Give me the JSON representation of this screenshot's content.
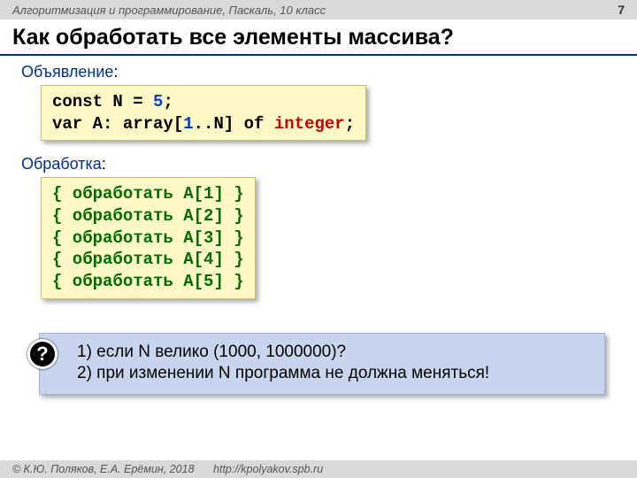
{
  "header": {
    "course": "Алгоритмизация и программирование, Паскаль, 10 класс",
    "page": "7"
  },
  "title": "Как обработать все элементы массива?",
  "sections": {
    "decl_label": "Объявление",
    "proc_label": "Обработка"
  },
  "code_decl": {
    "p1": "const N",
    "eq": "=",
    "five": "5",
    "semi1": ";",
    "p2": "var A: array[",
    "one": "1",
    "range": "..N] ",
    "of": "of",
    "sp": " ",
    "int": "integer",
    "semi2": ";"
  },
  "code_proc": {
    "l1_a": "{ обработать A[",
    "l1_b": "1",
    "l1_c": "] }",
    "l2_a": "{ обработать A[",
    "l2_b": "2",
    "l2_c": "] }",
    "l3_a": "{ обработать A[",
    "l3_b": "3",
    "l3_c": "] }",
    "l4_a": "{ обработать A[",
    "l4_b": "4",
    "l4_c": "] }",
    "l5_a": "{ обработать A[",
    "l5_b": "5",
    "l5_c": "] }"
  },
  "question": {
    "mark": "?",
    "line1": "1) если N велико (1000, 1000000)?",
    "line2": "2) при изменении N программа не должна меняться!"
  },
  "footer": {
    "copyright": "© К.Ю. Поляков, Е.А. Ерёмин, 2018",
    "link": "http://kpolyakov.spb.ru"
  }
}
